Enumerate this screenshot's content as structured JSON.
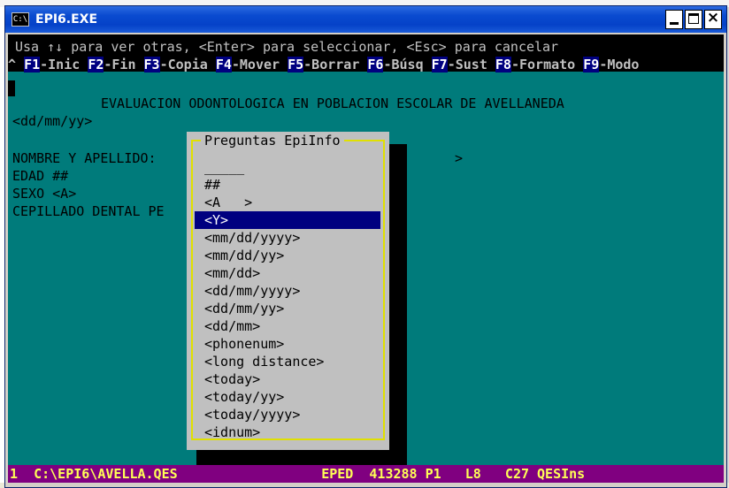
{
  "window": {
    "title": "EPI6.EXE",
    "icon_label": "C:\\"
  },
  "menubar": {
    "hint": "Usa ↑↓ para ver otras, <Enter> para seleccionar, <Esc> para cancelar",
    "prefix": "^ ",
    "fkeys": [
      {
        "key": "F1",
        "label": "-Inic "
      },
      {
        "key": "F2",
        "label": "-Fin "
      },
      {
        "key": "F3",
        "label": "-Copia "
      },
      {
        "key": "F4",
        "label": "-Mover "
      },
      {
        "key": "F5",
        "label": "-Borrar "
      },
      {
        "key": "F6",
        "label": "-Búsq "
      },
      {
        "key": "F7",
        "label": "-Sust "
      },
      {
        "key": "F8",
        "label": "-Formato "
      },
      {
        "key": "F9",
        "label": "-Modo"
      }
    ]
  },
  "form": {
    "heading": "EVALUACION ODONTOLOGICA EN POBLACION ESCOLAR DE AVELLANEDA",
    "date_field": "<dd/mm/yy>",
    "nombre": "NOMBRE Y APELLIDO:",
    "nombre_end": ">",
    "edad": "EDAD ##",
    "sexo": "SEXO <A>",
    "cepillado": "CEPILLADO DENTAL PE"
  },
  "popup": {
    "title": "Preguntas EpiInfo",
    "options": [
      "_____",
      "##",
      "<A   >",
      "<Y>",
      "<mm/dd/yyyy>",
      "<mm/dd/yy>",
      "<mm/dd>",
      "<dd/mm/yyyy>",
      "<dd/mm/yy>",
      "<dd/mm>",
      "<phonenum>",
      "<long distance>",
      "<today>",
      "<today/yy>",
      "<today/yyyy>",
      "<idnum>"
    ],
    "selected_index": 3
  },
  "statusbar": {
    "text": "1  C:\\EPI6\\AVELLA.QES                  EPED  413288 P1   L8   C27 QESIns"
  },
  "colors": {
    "console_bg": "#007b7b",
    "popup_bg": "#c0c0c0",
    "popup_border": "#e0e000",
    "selection": "#000080",
    "statusbar_bg": "#800080",
    "statusbar_fg": "#ffff55"
  }
}
